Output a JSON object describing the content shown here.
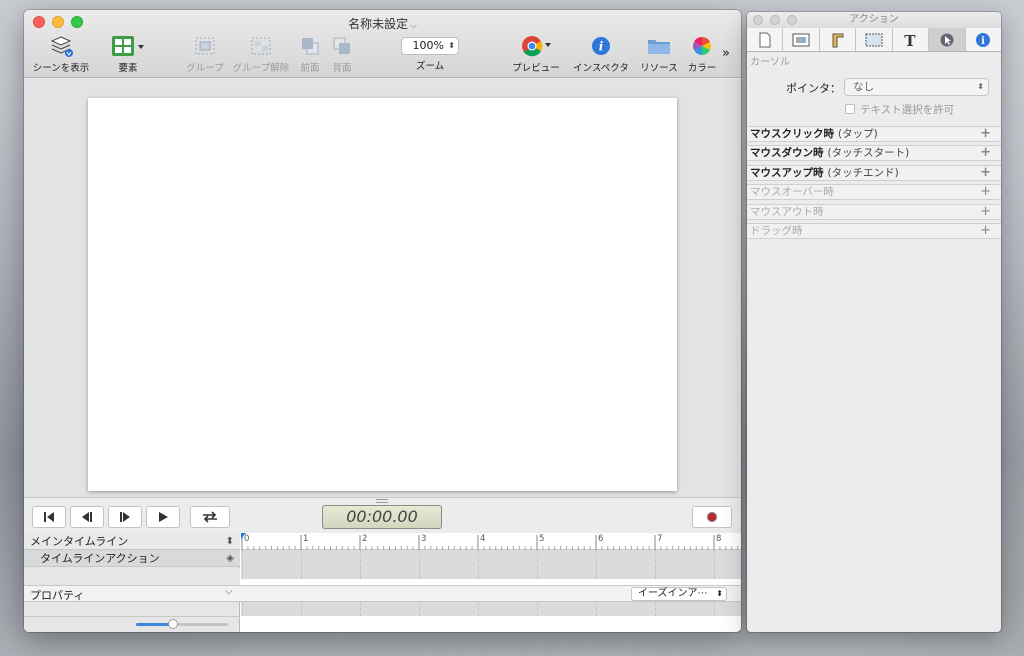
{
  "window": {
    "title": "名称未設定",
    "traffic_colors": {
      "close": "#fc605c",
      "minimize": "#fdbc40",
      "zoom": "#34c84a"
    }
  },
  "toolbar": {
    "show_scenes": "シーンを表示",
    "elements": "要素",
    "group": "グループ",
    "ungroup": "グループ解除",
    "front": "前面",
    "back": "背面",
    "zoom_value": "100%",
    "zoom_label": "ズーム",
    "preview": "プレビュー",
    "inspector": "インスペクタ",
    "resources": "リソース",
    "colors": "カラー",
    "overflow": "»"
  },
  "transport": {
    "timecode": "00:00.00"
  },
  "timeline": {
    "main_timeline": "メインタイムライン",
    "timeline_action": "タイムラインアクション",
    "properties": "プロパティ",
    "easing": "イーズインア⋯",
    "ruler_ticks": [
      "0",
      "1",
      "2",
      "3",
      "4",
      "5",
      "6",
      "7",
      "8"
    ],
    "zoom_level": 0.4
  },
  "inspector": {
    "title": "アクション",
    "section_cursor": "カーソル",
    "pointer_label": "ポインタ：",
    "pointer_value": "なし",
    "allow_text_select": "テキスト選択を許可",
    "events": [
      {
        "label": "マウスクリック時",
        "sub": "(タップ)",
        "enabled": true
      },
      {
        "label": "マウスダウン時",
        "sub": "(タッチスタート)",
        "enabled": true
      },
      {
        "label": "マウスアップ時",
        "sub": "(タッチエンド)",
        "enabled": true
      },
      {
        "label": "マウスオーバー時",
        "sub": "",
        "enabled": false
      },
      {
        "label": "マウスアウト時",
        "sub": "",
        "enabled": false
      },
      {
        "label": "ドラッグ時",
        "sub": "",
        "enabled": false
      }
    ]
  }
}
